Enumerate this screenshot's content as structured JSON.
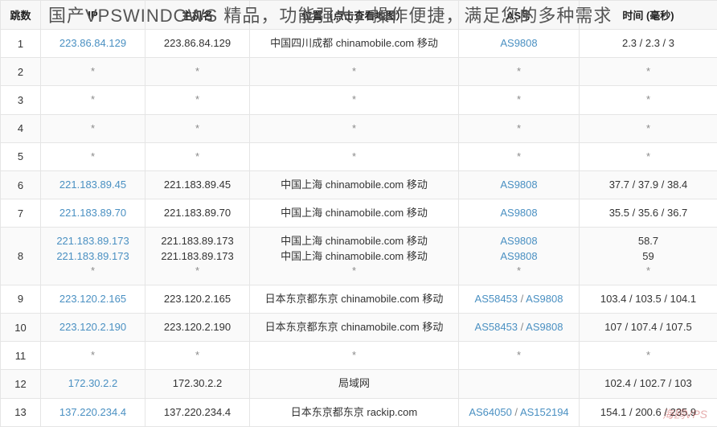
{
  "overlay_title": "国产VPSWINDOWS 精品，功能强大，操作便捷，满足您的多种需求",
  "watermark": "海鸥VPS",
  "columns": [
    "跳数",
    "IP",
    "主机名",
    "位置（点击查看地图）",
    "AS号",
    "时间 (毫秒)"
  ],
  "rows": [
    {
      "hop": "1",
      "ips": [
        "223.86.84.129"
      ],
      "hosts": [
        "223.86.84.129"
      ],
      "loc": [
        "中国四川成都 chinamobile.com 移动"
      ],
      "asn": [
        [
          "AS9808"
        ]
      ],
      "time": [
        "2.3 / 2.3 / 3"
      ]
    },
    {
      "hop": "2",
      "ips": [
        "*"
      ],
      "hosts": [
        "*"
      ],
      "loc": [
        "*"
      ],
      "asn": [
        [
          "*"
        ]
      ],
      "time": [
        "*"
      ]
    },
    {
      "hop": "3",
      "ips": [
        "*"
      ],
      "hosts": [
        "*"
      ],
      "loc": [
        "*"
      ],
      "asn": [
        [
          "*"
        ]
      ],
      "time": [
        "*"
      ]
    },
    {
      "hop": "4",
      "ips": [
        "*"
      ],
      "hosts": [
        "*"
      ],
      "loc": [
        "*"
      ],
      "asn": [
        [
          "*"
        ]
      ],
      "time": [
        "*"
      ]
    },
    {
      "hop": "5",
      "ips": [
        "*"
      ],
      "hosts": [
        "*"
      ],
      "loc": [
        "*"
      ],
      "asn": [
        [
          "*"
        ]
      ],
      "time": [
        "*"
      ]
    },
    {
      "hop": "6",
      "ips": [
        "221.183.89.45"
      ],
      "hosts": [
        "221.183.89.45"
      ],
      "loc": [
        "中国上海 chinamobile.com 移动"
      ],
      "asn": [
        [
          "AS9808"
        ]
      ],
      "time": [
        "37.7 / 37.9 / 38.4"
      ]
    },
    {
      "hop": "7",
      "ips": [
        "221.183.89.70"
      ],
      "hosts": [
        "221.183.89.70"
      ],
      "loc": [
        "中国上海 chinamobile.com 移动"
      ],
      "asn": [
        [
          "AS9808"
        ]
      ],
      "time": [
        "35.5 / 35.6 / 36.7"
      ]
    },
    {
      "hop": "8",
      "ips": [
        "221.183.89.173",
        "221.183.89.173",
        "*"
      ],
      "hosts": [
        "221.183.89.173",
        "221.183.89.173",
        "*"
      ],
      "loc": [
        "中国上海 chinamobile.com 移动",
        "中国上海 chinamobile.com 移动",
        "*"
      ],
      "asn": [
        [
          "AS9808"
        ],
        [
          "AS9808"
        ],
        [
          "*"
        ]
      ],
      "time": [
        "58.7",
        "59",
        "*"
      ]
    },
    {
      "hop": "9",
      "ips": [
        "223.120.2.165"
      ],
      "hosts": [
        "223.120.2.165"
      ],
      "loc": [
        "日本东京都东京 chinamobile.com 移动"
      ],
      "asn": [
        [
          "AS58453",
          "AS9808"
        ]
      ],
      "time": [
        "103.4 / 103.5 / 104.1"
      ]
    },
    {
      "hop": "10",
      "ips": [
        "223.120.2.190"
      ],
      "hosts": [
        "223.120.2.190"
      ],
      "loc": [
        "日本东京都东京 chinamobile.com 移动"
      ],
      "asn": [
        [
          "AS58453",
          "AS9808"
        ]
      ],
      "time": [
        "107 / 107.4 / 107.5"
      ]
    },
    {
      "hop": "11",
      "ips": [
        "*"
      ],
      "hosts": [
        "*"
      ],
      "loc": [
        "*"
      ],
      "asn": [
        [
          "*"
        ]
      ],
      "time": [
        "*"
      ]
    },
    {
      "hop": "12",
      "ips": [
        "172.30.2.2"
      ],
      "hosts": [
        "172.30.2.2"
      ],
      "loc": [
        "局域网"
      ],
      "asn": [
        [
          ""
        ]
      ],
      "time": [
        "102.4 / 102.7 / 103"
      ]
    },
    {
      "hop": "13",
      "ips": [
        "137.220.234.4"
      ],
      "hosts": [
        "137.220.234.4"
      ],
      "loc": [
        "日本东京都东京 rackip.com"
      ],
      "asn": [
        [
          "AS64050",
          "AS152194"
        ]
      ],
      "time": [
        "154.1 / 200.6 / 235.9"
      ]
    }
  ]
}
